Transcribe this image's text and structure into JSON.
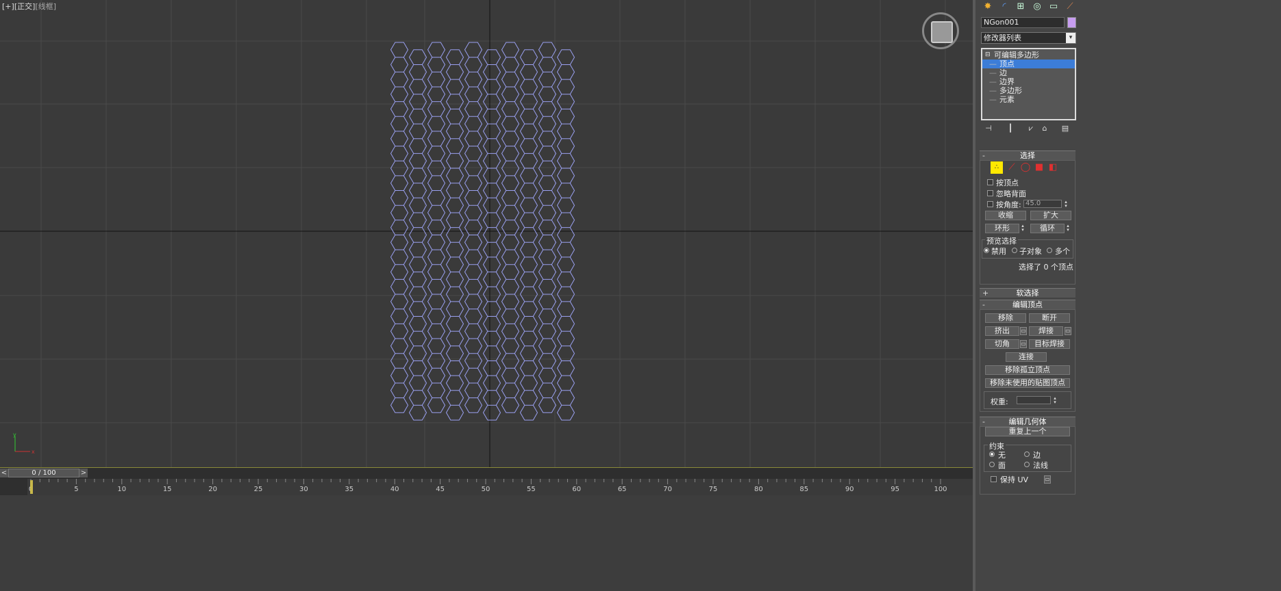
{
  "viewport": {
    "label_parts": [
      "[+]",
      "[正交]",
      "[线框]"
    ],
    "axis_labels": {
      "x": "x",
      "y": "y"
    }
  },
  "timeline": {
    "frame_readout": "0 / 100",
    "prev_arrow": "<",
    "next_arrow": ">",
    "ticks": [
      "0",
      "5",
      "10",
      "15",
      "20",
      "25",
      "30",
      "35",
      "40",
      "45",
      "50",
      "55",
      "60",
      "65",
      "70",
      "75",
      "80",
      "85",
      "90",
      "95",
      "100"
    ]
  },
  "command_panel": {
    "tabs": [
      "create-icon",
      "modify-icon",
      "hierarchy-icon",
      "motion-icon",
      "display-icon",
      "utilities-icon"
    ],
    "object_name": "NGon001",
    "object_color": "#c79df0",
    "modifier_list": "修改器列表",
    "stack": {
      "root": "可编辑多边形",
      "items": [
        "顶点",
        "边",
        "边界",
        "多边形",
        "元素"
      ],
      "selected": "顶点"
    }
  },
  "selection_rollout": {
    "title": "选择",
    "by_vertex": "按顶点",
    "ignore_backfacing": "忽略背面",
    "by_angle": "按角度:",
    "angle_value": "45.0",
    "shrink": "收缩",
    "grow": "扩大",
    "ring": "环形",
    "loop": "循环",
    "preview_title": "预览选择",
    "preview_options": [
      "禁用",
      "子对象",
      "多个"
    ],
    "status": "选择了 0 个顶点"
  },
  "soft_selection": {
    "title": "软选择"
  },
  "edit_vertices": {
    "title": "编辑顶点",
    "remove": "移除",
    "break": "断开",
    "extrude": "挤出",
    "weld": "焊接",
    "chamfer": "切角",
    "target_weld": "目标焊接",
    "connect": "连接",
    "remove_isolated": "移除孤立顶点",
    "remove_unused_map": "移除未使用的贴图顶点",
    "weight_label": "权重:"
  },
  "edit_geometry": {
    "title": "编辑几何体",
    "repeat_last": "重复上一个",
    "constraints_title": "约束",
    "constraints": [
      "无",
      "边",
      "面",
      "法线"
    ],
    "preserve_uv": "保持 UV"
  }
}
